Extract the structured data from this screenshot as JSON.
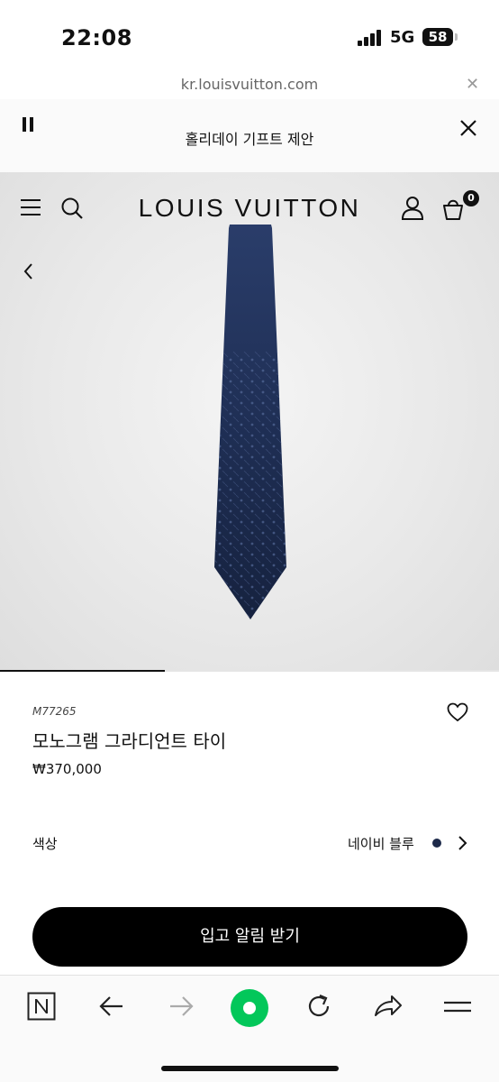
{
  "status_bar": {
    "time": "22:08",
    "network": "5G",
    "battery": "58"
  },
  "url_bar": {
    "domain": "kr.louisvuitton.com",
    "close_icon": "close-icon"
  },
  "promo_banner": {
    "text": "홀리데이 기프트 제안",
    "pause_icon": "pause-icon",
    "close_icon": "close-icon"
  },
  "header": {
    "brand": "LOUIS VUITTON",
    "menu_icon": "menu-icon",
    "search_icon": "search-icon",
    "account_icon": "user-icon",
    "cart_icon": "shopping-bag-icon",
    "cart_count": "0",
    "back_icon": "chevron-left-icon"
  },
  "gallery": {
    "progress_fraction": 0.33
  },
  "product": {
    "sku": "M77265",
    "name": "모노그램 그라디언트 타이",
    "price": "₩370,000",
    "wishlist_icon": "heart-icon"
  },
  "color_selector": {
    "label": "색상",
    "value": "네이비 블루",
    "swatch_color": "#1d2a4a"
  },
  "cta": {
    "label": "입고 알림 받기"
  },
  "browser_toolbar": {
    "items": [
      "naver-n-icon",
      "back-arrow-icon",
      "forward-arrow-icon",
      "green-home-dot-icon",
      "reload-icon",
      "share-icon",
      "menu-icon"
    ],
    "accent": "#03c75a"
  }
}
